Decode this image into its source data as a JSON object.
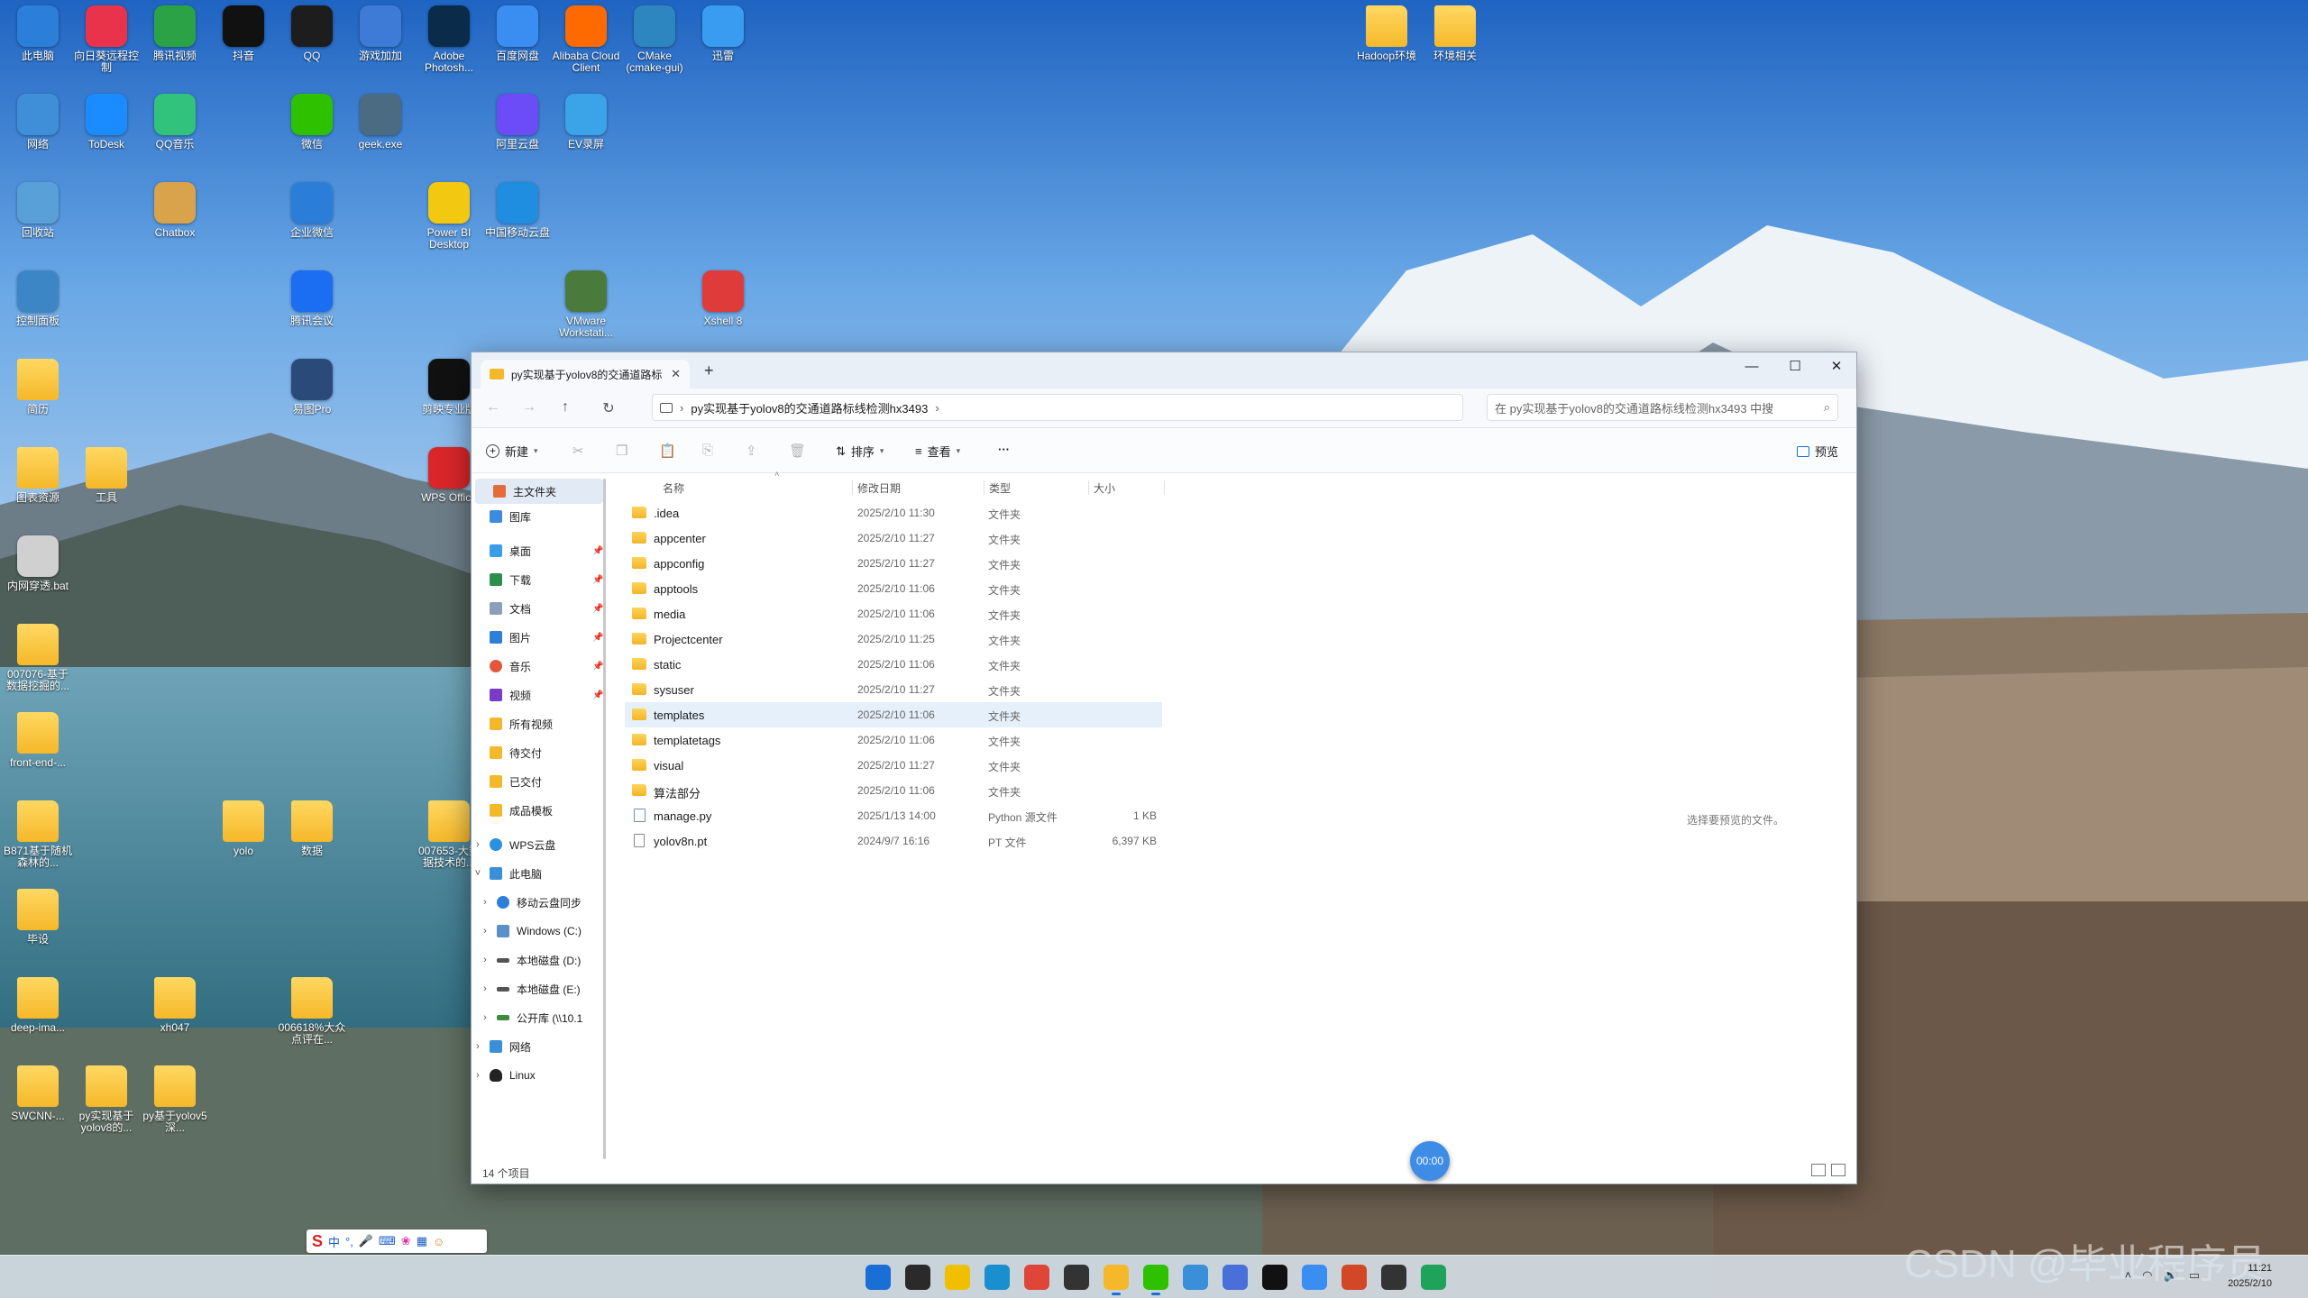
{
  "desktop_icons": [
    {
      "label": "此电脑",
      "icon": "computer-icon",
      "color": "#2b7fd8",
      "folder": false
    },
    {
      "label": "向日葵远程控制",
      "icon": "sunlogin-icon",
      "color": "#e8334a",
      "folder": false
    },
    {
      "label": "腾讯视频",
      "icon": "tencent-video-icon",
      "color": "#2ba245",
      "folder": false
    },
    {
      "label": "抖音",
      "icon": "douyin-icon",
      "color": "#111111",
      "folder": false
    },
    {
      "label": "QQ",
      "icon": "qq-icon",
      "color": "#1d1d1d",
      "folder": false
    },
    {
      "label": "游戏加加",
      "icon": "game-plus-icon",
      "color": "#3e7bd6",
      "folder": false
    },
    {
      "label": "Adobe Photosh...",
      "icon": "photoshop-icon",
      "color": "#0a2b49",
      "folder": false
    },
    {
      "label": "百度网盘",
      "icon": "baidu-netdisk-icon",
      "color": "#3a8ef2",
      "folder": false
    },
    {
      "label": "Alibaba Cloud Client",
      "icon": "alibaba-cloud-icon",
      "color": "#ff6a00",
      "folder": false
    },
    {
      "label": "CMake (cmake-gui)",
      "icon": "cmake-icon",
      "color": "#2e86c1",
      "folder": false
    },
    {
      "label": "迅雷",
      "icon": "xunlei-icon",
      "color": "#3a9cf0",
      "folder": false
    },
    {
      "label": "Hadoop环境",
      "icon": "folder-icon",
      "color": "#f5b82a",
      "folder": true
    },
    {
      "label": "环境相关",
      "icon": "folder-icon",
      "color": "#f5b82a",
      "folder": true
    },
    {
      "label": "网络",
      "icon": "network-icon",
      "color": "#3f8fd8",
      "folder": false
    },
    {
      "label": "ToDesk",
      "icon": "todesk-icon",
      "color": "#1a8cff",
      "folder": false
    },
    {
      "label": "QQ音乐",
      "icon": "qq-music-icon",
      "color": "#31c27c",
      "folder": false
    },
    {
      "label": "微信",
      "icon": "wechat-icon",
      "color": "#2dc100",
      "folder": false
    },
    {
      "label": "geek.exe",
      "icon": "geek-icon",
      "color": "#4a6b82",
      "folder": false
    },
    {
      "label": "阿里云盘",
      "icon": "aliyun-drive-icon",
      "color": "#6b4cf6",
      "folder": false
    },
    {
      "label": "EV录屏",
      "icon": "ev-recorder-icon",
      "color": "#3ba3e8",
      "folder": false
    },
    {
      "label": "回收站",
      "icon": "recycle-bin-icon",
      "color": "#5aa0d8",
      "folder": false
    },
    {
      "label": "Chatbox",
      "icon": "chatbox-icon",
      "color": "#d8a34a",
      "folder": false
    },
    {
      "label": "企业微信",
      "icon": "wecom-icon",
      "color": "#2b7ed8",
      "folder": false
    },
    {
      "label": "Power BI Desktop",
      "icon": "powerbi-icon",
      "color": "#f2c811",
      "folder": false
    },
    {
      "label": "中国移动云盘",
      "icon": "china-mobile-cloud-icon",
      "color": "#1f8de0",
      "folder": false
    },
    {
      "label": "控制面板",
      "icon": "control-panel-icon",
      "color": "#3d86c6",
      "folder": false
    },
    {
      "label": "腾讯会议",
      "icon": "tencent-meeting-icon",
      "color": "#1b6df2",
      "folder": false
    },
    {
      "label": "VMware Workstati...",
      "icon": "vmware-icon",
      "color": "#4a7a3c",
      "folder": false
    },
    {
      "label": "Xshell 8",
      "icon": "xshell-icon",
      "color": "#e03b3b",
      "folder": false
    },
    {
      "label": "简历",
      "icon": "folder-icon",
      "color": "#f5b82a",
      "folder": true
    },
    {
      "label": "易图Pro",
      "icon": "yitu-pro-icon",
      "color": "#2a4a7a",
      "folder": false
    },
    {
      "label": "剪映专业版",
      "icon": "capcut-icon",
      "color": "#111111",
      "folder": false
    },
    {
      "label": "图表资源",
      "icon": "folder-icon",
      "color": "#f5b82a",
      "folder": true
    },
    {
      "label": "工具",
      "icon": "folder-icon",
      "color": "#f5b82a",
      "folder": true
    },
    {
      "label": "WPS Office",
      "icon": "wps-icon",
      "color": "#d9262a",
      "folder": false
    },
    {
      "label": "内网穿透.bat",
      "icon": "bat-file-icon",
      "color": "#d0d0d0",
      "folder": false
    },
    {
      "label": "007076-基于数据挖掘的...",
      "icon": "folder-icon",
      "color": "#f5b82a",
      "folder": true
    },
    {
      "label": "front-end-...",
      "icon": "folder-icon",
      "color": "#f5b82a",
      "folder": true
    },
    {
      "label": "yolo",
      "icon": "folder-icon",
      "color": "#f5b82a",
      "folder": true
    },
    {
      "label": "数据",
      "icon": "folder-icon",
      "color": "#f5b82a",
      "folder": true
    },
    {
      "label": "007653-大数据技术的...",
      "icon": "folder-icon",
      "color": "#f5b82a",
      "folder": true
    },
    {
      "label": "B871基于随机森林的...",
      "icon": "folder-icon",
      "color": "#f5b82a",
      "folder": true
    },
    {
      "label": "毕设",
      "icon": "folder-icon",
      "color": "#f5b82a",
      "folder": true
    },
    {
      "label": "deep-ima...",
      "icon": "folder-icon",
      "color": "#f5b82a",
      "folder": true
    },
    {
      "label": "xh047",
      "icon": "folder-icon",
      "color": "#f5b82a",
      "folder": true
    },
    {
      "label": "006618%大众点评在...",
      "icon": "folder-icon",
      "color": "#f5b82a",
      "folder": true
    },
    {
      "label": "SWCNN-...",
      "icon": "folder-icon",
      "color": "#f5b82a",
      "folder": true
    },
    {
      "label": "py实现基于yolov8的...",
      "icon": "folder-icon",
      "color": "#f5b82a",
      "folder": true
    },
    {
      "label": "py基于yolov5深...",
      "icon": "folder-icon",
      "color": "#f5b82a",
      "folder": true
    }
  ],
  "explorer": {
    "tab_title": "py实现基于yolov8的交通道路标",
    "address_path": "py实现基于yolov8的交通道路标线检测hx3493",
    "search_placeholder": "在 py实现基于yolov8的交通道路标线检测hx3493 中搜",
    "toolbar": {
      "new_label": "新建",
      "sort_label": "排序",
      "view_label": "查看",
      "more_label": "···",
      "preview_label": "预览"
    },
    "nav": {
      "home": "主文件夹",
      "gallery": "图库",
      "desktop": "桌面",
      "downloads": "下载",
      "documents": "文档",
      "pictures": "图片",
      "music": "音乐",
      "videos": "视频",
      "all_videos": "所有视频",
      "pending": "待交付",
      "delivered": "已交付",
      "templates": "成品模板",
      "wps_cloud": "WPS云盘",
      "this_pc": "此电脑",
      "mobile_sync": "移动云盘同步",
      "drive_c": "Windows (C:)",
      "drive_d": "本地磁盘 (D:)",
      "drive_e": "本地磁盘 (E:)",
      "public_share": "公开库 (\\\\10.1",
      "network": "网络",
      "linux": "Linux"
    },
    "columns": {
      "name": "名称",
      "date": "修改日期",
      "type": "类型",
      "size": "大小"
    },
    "files": [
      {
        "name": ".idea",
        "date": "2025/2/10 11:30",
        "type": "文件夹",
        "size": "",
        "kind": "folder"
      },
      {
        "name": "appcenter",
        "date": "2025/2/10 11:27",
        "type": "文件夹",
        "size": "",
        "kind": "folder"
      },
      {
        "name": "appconfig",
        "date": "2025/2/10 11:27",
        "type": "文件夹",
        "size": "",
        "kind": "folder"
      },
      {
        "name": "apptools",
        "date": "2025/2/10 11:06",
        "type": "文件夹",
        "size": "",
        "kind": "folder"
      },
      {
        "name": "media",
        "date": "2025/2/10 11:06",
        "type": "文件夹",
        "size": "",
        "kind": "folder"
      },
      {
        "name": "Projectcenter",
        "date": "2025/2/10 11:25",
        "type": "文件夹",
        "size": "",
        "kind": "folder"
      },
      {
        "name": "static",
        "date": "2025/2/10 11:06",
        "type": "文件夹",
        "size": "",
        "kind": "folder"
      },
      {
        "name": "sysuser",
        "date": "2025/2/10 11:27",
        "type": "文件夹",
        "size": "",
        "kind": "folder"
      },
      {
        "name": "templates",
        "date": "2025/2/10 11:06",
        "type": "文件夹",
        "size": "",
        "kind": "folder"
      },
      {
        "name": "templatetags",
        "date": "2025/2/10 11:06",
        "type": "文件夹",
        "size": "",
        "kind": "folder"
      },
      {
        "name": "visual",
        "date": "2025/2/10 11:27",
        "type": "文件夹",
        "size": "",
        "kind": "folder"
      },
      {
        "name": "算法部分",
        "date": "2025/2/10 11:06",
        "type": "文件夹",
        "size": "",
        "kind": "folder"
      },
      {
        "name": "manage.py",
        "date": "2025/1/13 14:00",
        "type": "Python 源文件",
        "size": "1 KB",
        "kind": "py"
      },
      {
        "name": "yolov8n.pt",
        "date": "2024/9/7 16:16",
        "type": "PT 文件",
        "size": "6,397 KB",
        "kind": "file"
      }
    ],
    "hovered_file": "templates",
    "preview_hint": "选择要预览的文件。",
    "status_count": "14 个项目"
  },
  "recording_timer": "00:00",
  "ime": {
    "lang": "中",
    "punct": "°,"
  },
  "taskbar": {
    "apps": [
      "start-icon",
      "file-explorer-icon",
      "norton-icon",
      "edge-icon",
      "chrome-icon",
      "obs-icon",
      "folder-icon",
      "wechat-icon",
      "chat-icon",
      "network-tool-icon",
      "qq-icon",
      "baidu-icon",
      "powerpoint-icon",
      "typora-icon",
      "pycharm-icon"
    ],
    "clock_time": "11:21",
    "clock_date": "2025/2/10"
  },
  "watermark": "CSDN @毕业程序员"
}
